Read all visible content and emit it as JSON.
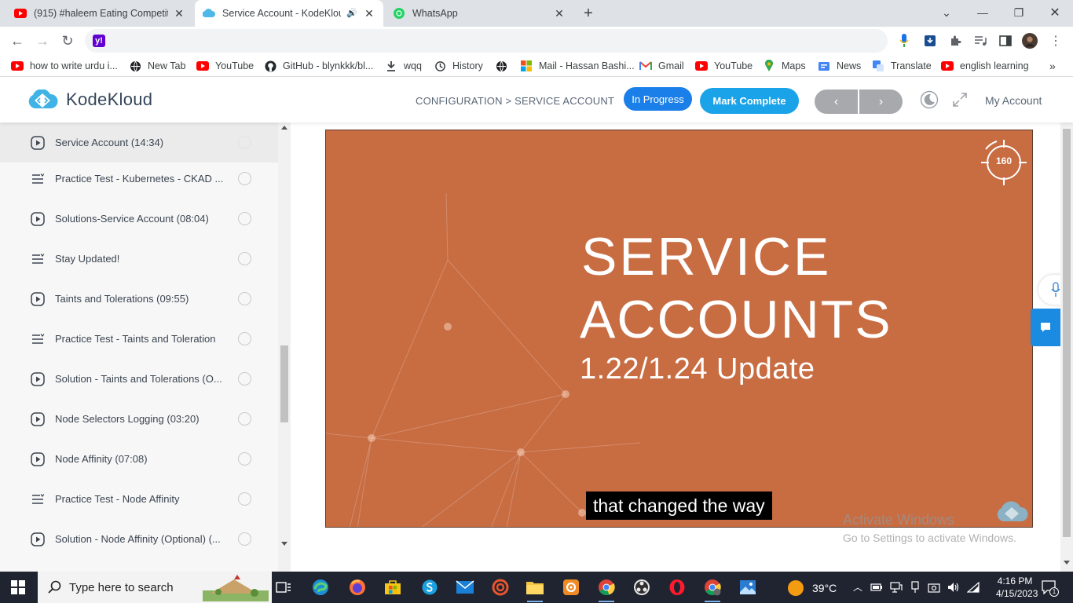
{
  "browser": {
    "tabs": [
      {
        "title": "(915) #haleem Eating Competitio",
        "favicon": "youtube-icon",
        "active": false
      },
      {
        "title": "Service Account - KodeKloud",
        "favicon": "kodekloud-icon",
        "active": true
      },
      {
        "title": "WhatsApp",
        "favicon": "whatsapp-icon",
        "active": false
      }
    ],
    "new_tab_label": "+",
    "address": "",
    "bookmarks": [
      {
        "label": "how to write urdu i...",
        "icon": "youtube-icon"
      },
      {
        "label": "New Tab",
        "icon": "globe-icon"
      },
      {
        "label": "YouTube",
        "icon": "youtube-icon"
      },
      {
        "label": "GitHub - blynkkk/bl...",
        "icon": "github-icon"
      },
      {
        "label": "wqq",
        "icon": "download-icon"
      },
      {
        "label": "History",
        "icon": "history-icon"
      },
      {
        "label": "",
        "icon": "globe-icon"
      },
      {
        "label": "Mail - Hassan Bashi...",
        "icon": "microsoft-icon"
      },
      {
        "label": "Gmail",
        "icon": "gmail-icon"
      },
      {
        "label": "YouTube",
        "icon": "youtube-icon"
      },
      {
        "label": "Maps",
        "icon": "maps-icon"
      },
      {
        "label": "News",
        "icon": "news-icon"
      },
      {
        "label": "Translate",
        "icon": "translate-icon"
      },
      {
        "label": "english learning",
        "icon": "youtube-icon"
      }
    ]
  },
  "header": {
    "logo_text": "KodeKloud",
    "breadcrumb": "CONFIGURATION > SERVICE ACCOUNT",
    "status_button": "In Progress",
    "complete_button": "Mark Complete",
    "prev_label": "‹",
    "next_label": "›",
    "account_label": "My Account"
  },
  "sidebar": {
    "lessons": [
      {
        "label": "Service Account (14:34)",
        "type": "video",
        "current": true
      },
      {
        "label": "Practice Test - Kubernetes - CKAD ...",
        "type": "lab",
        "current": false
      },
      {
        "label": "Solutions-Service Account (08:04)",
        "type": "video",
        "current": false
      },
      {
        "label": "Stay Updated!",
        "type": "lab",
        "current": false
      },
      {
        "label": "Taints and Tolerations (09:55)",
        "type": "video",
        "current": false
      },
      {
        "label": "Practice Test - Taints and Toleration",
        "type": "lab",
        "current": false
      },
      {
        "label": "Solution - Taints and Tolerations (O...",
        "type": "video",
        "current": false
      },
      {
        "label": "Node Selectors Logging (03:20)",
        "type": "video",
        "current": false
      },
      {
        "label": "Node Affinity (07:08)",
        "type": "video",
        "current": false
      },
      {
        "label": "Practice Test - Node Affinity",
        "type": "lab",
        "current": false
      },
      {
        "label": "Solution - Node Affinity (Optional) (...",
        "type": "video",
        "current": false
      }
    ]
  },
  "video": {
    "title_line1": "SERVICE",
    "title_line2": "ACCOUNTS",
    "subtitle": "1.22/1.24 Update",
    "badge": "160",
    "caption": "that changed the way"
  },
  "watermark": {
    "line1": "Activate Windows",
    "line2": "Go to Settings to activate Windows."
  },
  "taskbar": {
    "search_placeholder": "Type here to search",
    "weather": "39°C",
    "time": "4:16 PM",
    "date": "4/15/2023",
    "notification_count": "1"
  }
}
